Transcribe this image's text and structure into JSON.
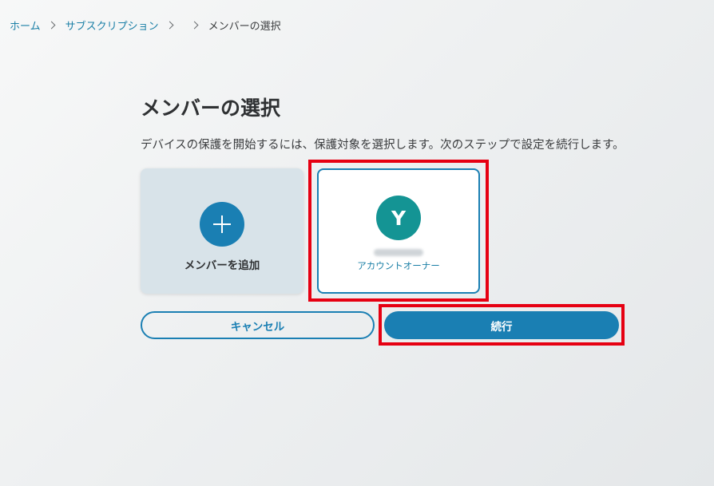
{
  "breadcrumb": {
    "home": "ホーム",
    "subscription": "サブスクリプション",
    "current": "メンバーの選択"
  },
  "page": {
    "title": "メンバーの選択",
    "description": "デバイスの保護を開始するには、保護対象を選択します。次のステップで設定を続行します。"
  },
  "cards": {
    "add_member": {
      "label": "メンバーを追加",
      "icon": "plus-icon"
    },
    "member": {
      "initial": "Y",
      "role": "アカウントオーナー",
      "avatar_color": "#149494"
    }
  },
  "buttons": {
    "cancel": "キャンセル",
    "continue": "続行"
  },
  "colors": {
    "accent": "#1a7fb3",
    "link": "#1a7fa6",
    "highlight": "#e60012"
  }
}
